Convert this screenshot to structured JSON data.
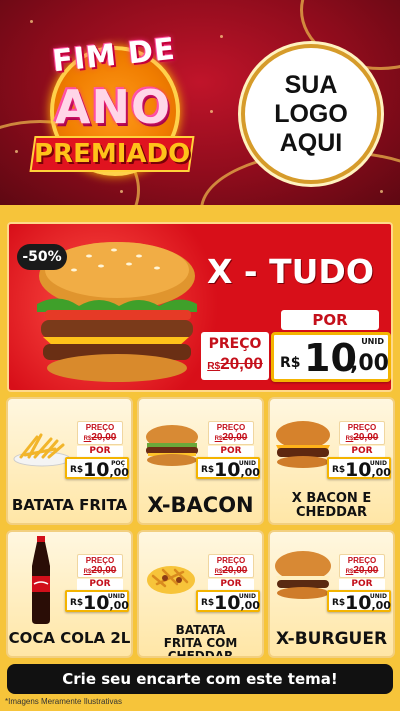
{
  "header": {
    "fim_de": "FIM DE",
    "ano": "ANO",
    "premiado": "PREMIADO",
    "logo_line1": "SUA",
    "logo_line2": "LOGO",
    "logo_line3": "AQUI"
  },
  "featured": {
    "discount": "-50%",
    "title": "X - TUDO",
    "preco_label": "PREÇO",
    "old_currency": "R$",
    "old_price": "20,00",
    "por_label": "POR",
    "currency": "R$",
    "price_int": "10",
    "price_cents": ",00",
    "unit": "UNID"
  },
  "products": [
    {
      "name": "BATATA FRITA",
      "preco_label": "PREÇO",
      "old_currency": "R$",
      "old_price": "20,00",
      "por_label": "POR",
      "currency": "R$",
      "price_int": "10",
      "price_cents": ",00",
      "unit": "POÇ"
    },
    {
      "name": "X-BACON",
      "preco_label": "PREÇO",
      "old_currency": "R$",
      "old_price": "20,00",
      "por_label": "POR",
      "currency": "R$",
      "price_int": "10",
      "price_cents": ",00",
      "unit": "UNID"
    },
    {
      "name": "X BACON E CHEDDAR",
      "preco_label": "PREÇO",
      "old_currency": "R$",
      "old_price": "20,00",
      "por_label": "POR",
      "currency": "R$",
      "price_int": "10",
      "price_cents": ",00",
      "unit": "UNID"
    },
    {
      "name": "COCA COLA 2L",
      "preco_label": "PREÇO",
      "old_currency": "R$",
      "old_price": "20,00",
      "por_label": "POR",
      "currency": "R$",
      "price_int": "10",
      "price_cents": ",00",
      "unit": "UNID"
    },
    {
      "name": "BATATA FRITA COM CHEDDAR",
      "preco_label": "PREÇO",
      "old_currency": "R$",
      "old_price": "20,00",
      "por_label": "POR",
      "currency": "R$",
      "price_int": "10",
      "price_cents": ",00",
      "unit": "UNID"
    },
    {
      "name": "X-BURGUER",
      "preco_label": "PREÇO",
      "old_currency": "R$",
      "old_price": "20,00",
      "por_label": "POR",
      "currency": "R$",
      "price_int": "10",
      "price_cents": ",00",
      "unit": "UNID"
    }
  ],
  "cta": "Crie seu encarte com este tema!",
  "footnote": "*Imagens Meramente Ilustrativas",
  "colors": {
    "red": "#d80f19",
    "gold": "#f4b400",
    "dark_red": "#8e0c1c"
  }
}
